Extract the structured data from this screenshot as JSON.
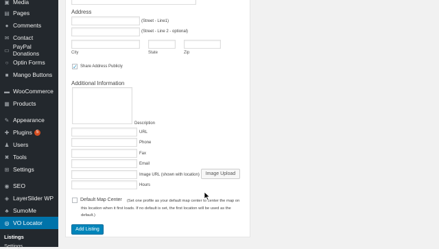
{
  "sidebar": {
    "items": [
      {
        "label": "Media",
        "icon": "media-icon"
      },
      {
        "label": "Pages",
        "icon": "pages-icon"
      },
      {
        "label": "Comments",
        "icon": "comments-icon"
      },
      {
        "label": "Contact",
        "icon": "envelope-icon"
      },
      {
        "label": "PayPal Donations",
        "icon": "paypal-icon"
      },
      {
        "label": "Optin Forms",
        "icon": "optin-icon"
      },
      {
        "label": "Mango Buttons",
        "icon": "buttons-icon"
      },
      {
        "label": "WooCommerce",
        "icon": "woocommerce-icon"
      },
      {
        "label": "Products",
        "icon": "products-icon"
      },
      {
        "label": "Appearance",
        "icon": "brush-icon"
      },
      {
        "label": "Plugins",
        "icon": "plugin-icon",
        "badge": "5"
      },
      {
        "label": "Users",
        "icon": "users-icon"
      },
      {
        "label": "Tools",
        "icon": "wrench-icon"
      },
      {
        "label": "Settings",
        "icon": "settings-icon"
      },
      {
        "label": "SEO",
        "icon": "seo-icon"
      },
      {
        "label": "LayerSlider WP",
        "icon": "layers-icon"
      },
      {
        "label": "SumoMe",
        "icon": "sumome-icon"
      },
      {
        "label": "VO Locator",
        "icon": "locator-icon",
        "active": true
      }
    ],
    "submenu": [
      "Listings",
      "Settings"
    ]
  },
  "form": {
    "address_heading": "Address",
    "street1_hint": "(Street - Line1)",
    "street2_hint": "(Street - Line 2 - optional)",
    "city_label": "City",
    "state_label": "State",
    "zip_label": "Zip",
    "share_label": "Share Address Publicly",
    "share_checked": true,
    "additional_heading": "Additional Information",
    "description_label": "Description",
    "url_label": "URL",
    "phone_label": "Phone",
    "fax_label": "Fax",
    "email_label": "Email",
    "image_label": "Image URL (shown with location)",
    "image_upload_button": "Image Upload",
    "hours_label": "Hours",
    "default_center_label": "Default Map Center",
    "default_center_note": "(Set one profile as your default map center to center the map on this location when it first loads. If no default is set, the first location will be used as the default.)",
    "add_listing_button": "Add Listing"
  }
}
